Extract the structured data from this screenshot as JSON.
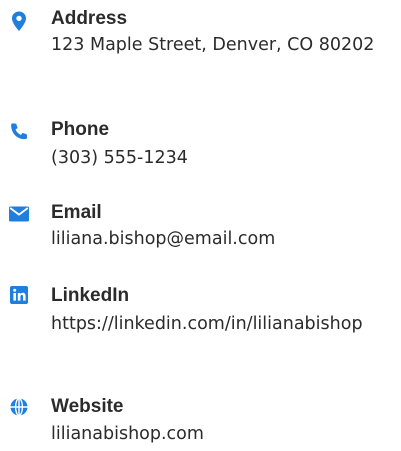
{
  "accent_color": "#1e7fe0",
  "contacts": [
    {
      "icon": "map-pin-icon",
      "label": "Address",
      "value": "123 Maple Street, Denver, CO 80202"
    },
    {
      "icon": "phone-icon",
      "label": "Phone",
      "value": "(303) 555-1234"
    },
    {
      "icon": "envelope-icon",
      "label": "Email",
      "value": "liliana.bishop@email.com"
    },
    {
      "icon": "linkedin-icon",
      "label": "LinkedIn",
      "value": "https://linkedin.com/in/lilianabishop"
    },
    {
      "icon": "globe-icon",
      "label": "Website",
      "value": "lilianabishop.com"
    }
  ]
}
